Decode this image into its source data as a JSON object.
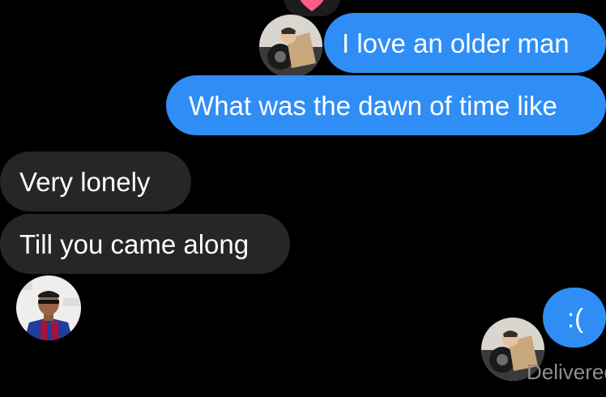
{
  "conversation": {
    "messages": [
      {
        "text": "I love an older man",
        "direction": "sent",
        "reaction": "heart"
      },
      {
        "text": "What was the dawn of time like",
        "direction": "sent"
      },
      {
        "text": "Very lonely",
        "direction": "received"
      },
      {
        "text": "Till you came along",
        "direction": "received"
      },
      {
        "text": ":(",
        "direction": "sent"
      }
    ],
    "status": "Delivered"
  },
  "colors": {
    "sent_bubble": "#2f8ef5",
    "received_bubble": "#262628",
    "background": "#000000",
    "heart": "#ff5a8a"
  },
  "icons": {
    "reaction": "heart-icon"
  }
}
